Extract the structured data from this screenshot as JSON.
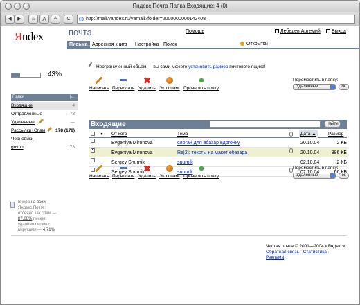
{
  "window": {
    "title": "Яндекс.Почта Папка Входящие: 4 (0)"
  },
  "browser": {
    "url": "http://mail.yandex.ru/yamail?folder=2000000000142408",
    "btn_back": "◀",
    "btn_fwd": "▶",
    "btn_home": "⌂",
    "btn_font_big": "A",
    "btn_font_small": "A",
    "btn_reload": "C"
  },
  "header": {
    "logo_ya": "Я",
    "logo_rest": "ndex",
    "service": "почта",
    "help": "Помощь",
    "user": "Лебедев Артемий",
    "exit": "Выход"
  },
  "tabs": [
    "Письма",
    "Адресная книга",
    "Настройка",
    "Поиск"
  ],
  "cards": "Открытки",
  "notice": {
    "before": "Неограниченный объем — вы сами можете ",
    "link": "установить размер",
    "after": " почтового ящика!"
  },
  "quota": {
    "percent_text": "43%",
    "fill": 0.3
  },
  "folders_header": "Папки",
  "folders_toggle": "|←",
  "folders": [
    {
      "name": "Входящие",
      "count": "4"
    },
    {
      "name": "Отправленные",
      "count": "78"
    },
    {
      "name": "Удаленные",
      "count": "—"
    },
    {
      "name": "Рассылки+Спам",
      "count": "178 (178)"
    },
    {
      "name": "Черновики",
      "count": "—"
    },
    {
      "name": "gоvпo",
      "count": "73"
    }
  ],
  "sideinfo": {
    "l1": "Вчера ",
    "l1_link": "на всей",
    "l2": "Яндекс.Почте",
    "l2_rest": ":",
    "l3": "отсеяно как спам —",
    "l4_link": "87,68%",
    "l4_rest": " писем;",
    "l5": "удалено писем с",
    "l6": "вирусами — ",
    "l6_link": "4,71%",
    "l6_rest": "."
  },
  "actions": {
    "write": "Написать",
    "forward": "Переслать",
    "delete": "Удалить",
    "spam": "Это спам!",
    "check": "Проверить почту"
  },
  "move": {
    "label": "Переместить в папку:",
    "selected": "Удаленные",
    "ok": "ок"
  },
  "inbox": {
    "title": "Входящие",
    "find": "Найти"
  },
  "table": {
    "col_from": "От кого",
    "col_subject": "Тема",
    "col_date": "Дата ▲",
    "col_size": "Размер",
    "rows": [
      {
        "from": "Evgeniya Mironova",
        "subject": "слоган для ебазар вдогонку",
        "date": "20.10.04",
        "size": "2 КБ"
      },
      {
        "from": "Evgeniya Mironova",
        "subject": "Re[2]: тексты на макет ебазара",
        "date": "20.10.04",
        "size": "886 КБ"
      },
      {
        "from": "Sergey Snurnik",
        "subject": "snurnik",
        "date": "02.10.04",
        "size": "2 КБ"
      },
      {
        "from": "Sergey Snurnik",
        "subject": "snurnik",
        "date": "02.10.04",
        "size": "66 КБ"
      }
    ]
  },
  "footer": {
    "copy": "Чистая почта © 2001—2004 «Яндекс»",
    "feedback": "Обратная связь",
    "stats": "Статистика",
    "ads": "Реклама"
  },
  "colors": {
    "accent": "#6d8096",
    "link": "#0a2ab5",
    "logo_red": "#e52620"
  }
}
